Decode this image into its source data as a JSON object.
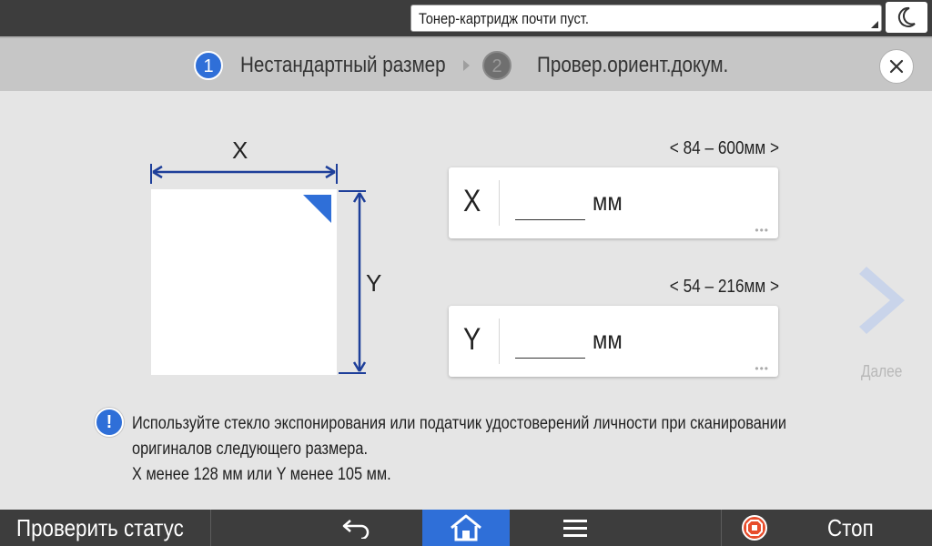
{
  "header": {
    "status_message": "Тонер-картридж почти пуст.",
    "night_mode_icon": "moon-icon"
  },
  "steps": [
    {
      "number": "1",
      "label": "Нестандартный размер",
      "active": true
    },
    {
      "number": "2",
      "label": "Провер.ориент.докум.",
      "active": false
    }
  ],
  "close_icon": "close-icon",
  "diagram": {
    "x_label": "X",
    "y_label": "Y"
  },
  "fields": {
    "x": {
      "range": "< 84 – 600мм >",
      "axis": "X",
      "value": "",
      "unit": "мм"
    },
    "y": {
      "range": "< 54 – 216мм >",
      "axis": "Y",
      "value": "",
      "unit": "мм"
    }
  },
  "next": {
    "label": "Далее"
  },
  "info": {
    "lines": [
      "Используйте стекло экспонирования или податчик удостоверений личности при сканировании",
      "оригиналов следующего размера.",
      "X менее 128 мм или Y менее 105 мм."
    ]
  },
  "footer": {
    "status_label": "Проверить статус",
    "stop_label": "Стоп"
  },
  "colors": {
    "accent": "#2f6fd8",
    "diagram_arrow": "#1e3f9a",
    "stop": "#e74c2b"
  }
}
